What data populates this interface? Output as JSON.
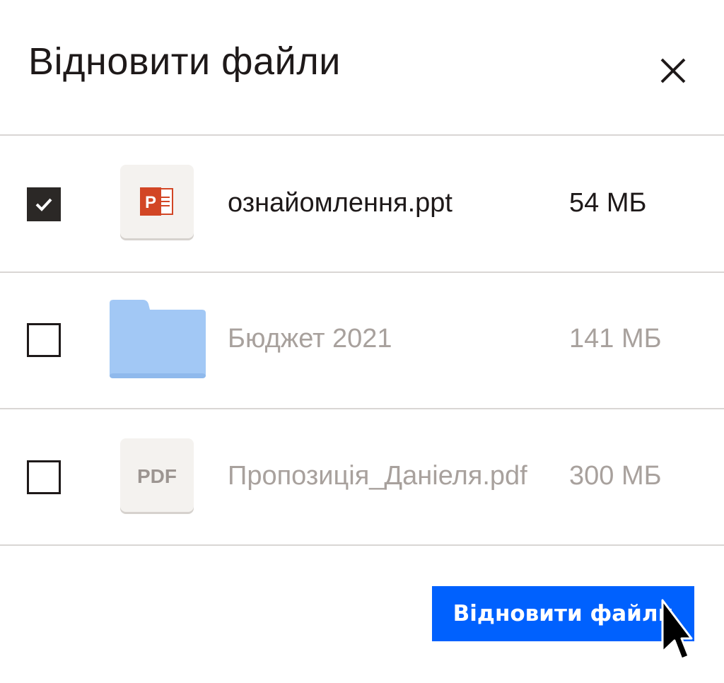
{
  "dialog": {
    "title": "Відновити файли",
    "close_icon": "close-icon"
  },
  "files": [
    {
      "name": "ознайомлення.ppt",
      "size": "54 МБ",
      "checked": true,
      "icon": "powerpoint-file-icon",
      "icon_color": "#d24625"
    },
    {
      "name": "Бюджет 2021",
      "size": "141 МБ",
      "checked": false,
      "icon": "folder-icon",
      "icon_color": "#a2c8f5"
    },
    {
      "name": "Пропозиція_Даніеля.pdf",
      "size": "300 МБ",
      "checked": false,
      "icon": "pdf-file-icon",
      "icon_label": "PDF"
    }
  ],
  "footer": {
    "restore_label": "Відновити файли"
  },
  "colors": {
    "accent": "#0061fe",
    "text": "#1e1919",
    "muted_text": "#a8a19d",
    "divider": "#d9d6d4"
  }
}
